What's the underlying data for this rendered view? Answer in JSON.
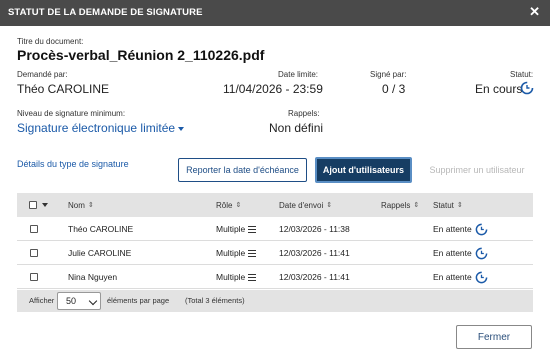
{
  "dialog": {
    "title": "STATUT DE LA DEMANDE DE SIGNATURE",
    "close": "✕"
  },
  "document": {
    "title_label": "Titre du document:",
    "title_value": "Procès-verbal_Réunion 2_110226.pdf",
    "requested_by_label": "Demandé par:",
    "requested_by_value": "Théo CAROLINE",
    "deadline_label": "Date limite:",
    "deadline_value": "11/04/2026 - 23:59",
    "signed_by_label": "Signé par:",
    "signed_by_value": "0 / 3",
    "status_label": "Statut:",
    "status_value": "En cours",
    "sig_level_label": "Niveau de signature minimum:",
    "sig_level_value": "Signature électronique limitée",
    "reminders_label": "Rappels:",
    "reminders_value": "Non défini"
  },
  "actions": {
    "details_link": "Détails du type de signature",
    "postpone_button": "Reporter la date d'échéance",
    "add_users_button": "Ajout d'utilisateurs",
    "remove_user_button": "Supprimer un utilisateur"
  },
  "table": {
    "columns": [
      "Nom",
      "Rôle",
      "Date d'envoi",
      "Rappels",
      "Statut"
    ],
    "rows": [
      {
        "name": "Théo CAROLINE",
        "role": "Multiple",
        "sent": "12/03/2026 - 11:38",
        "reminders": "",
        "status": "En attente"
      },
      {
        "name": "Julie CAROLINE",
        "role": "Multiple",
        "sent": "12/03/2026 - 11:41",
        "reminders": "",
        "status": "En attente"
      },
      {
        "name": "Nina Nguyen",
        "role": "Multiple",
        "sent": "12/03/2026 - 11:41",
        "reminders": "",
        "status": "En attente"
      }
    ]
  },
  "pagination": {
    "show_label": "Afficher",
    "page_size": "50",
    "per_page_label": "éléments par page",
    "total_label": "(Total 3 éléments)"
  },
  "close_button": "Fermer",
  "colors": {
    "titlebar": "#4a4a4a",
    "accent_blue": "#1b5aa8",
    "dark_button": "#163d63"
  }
}
